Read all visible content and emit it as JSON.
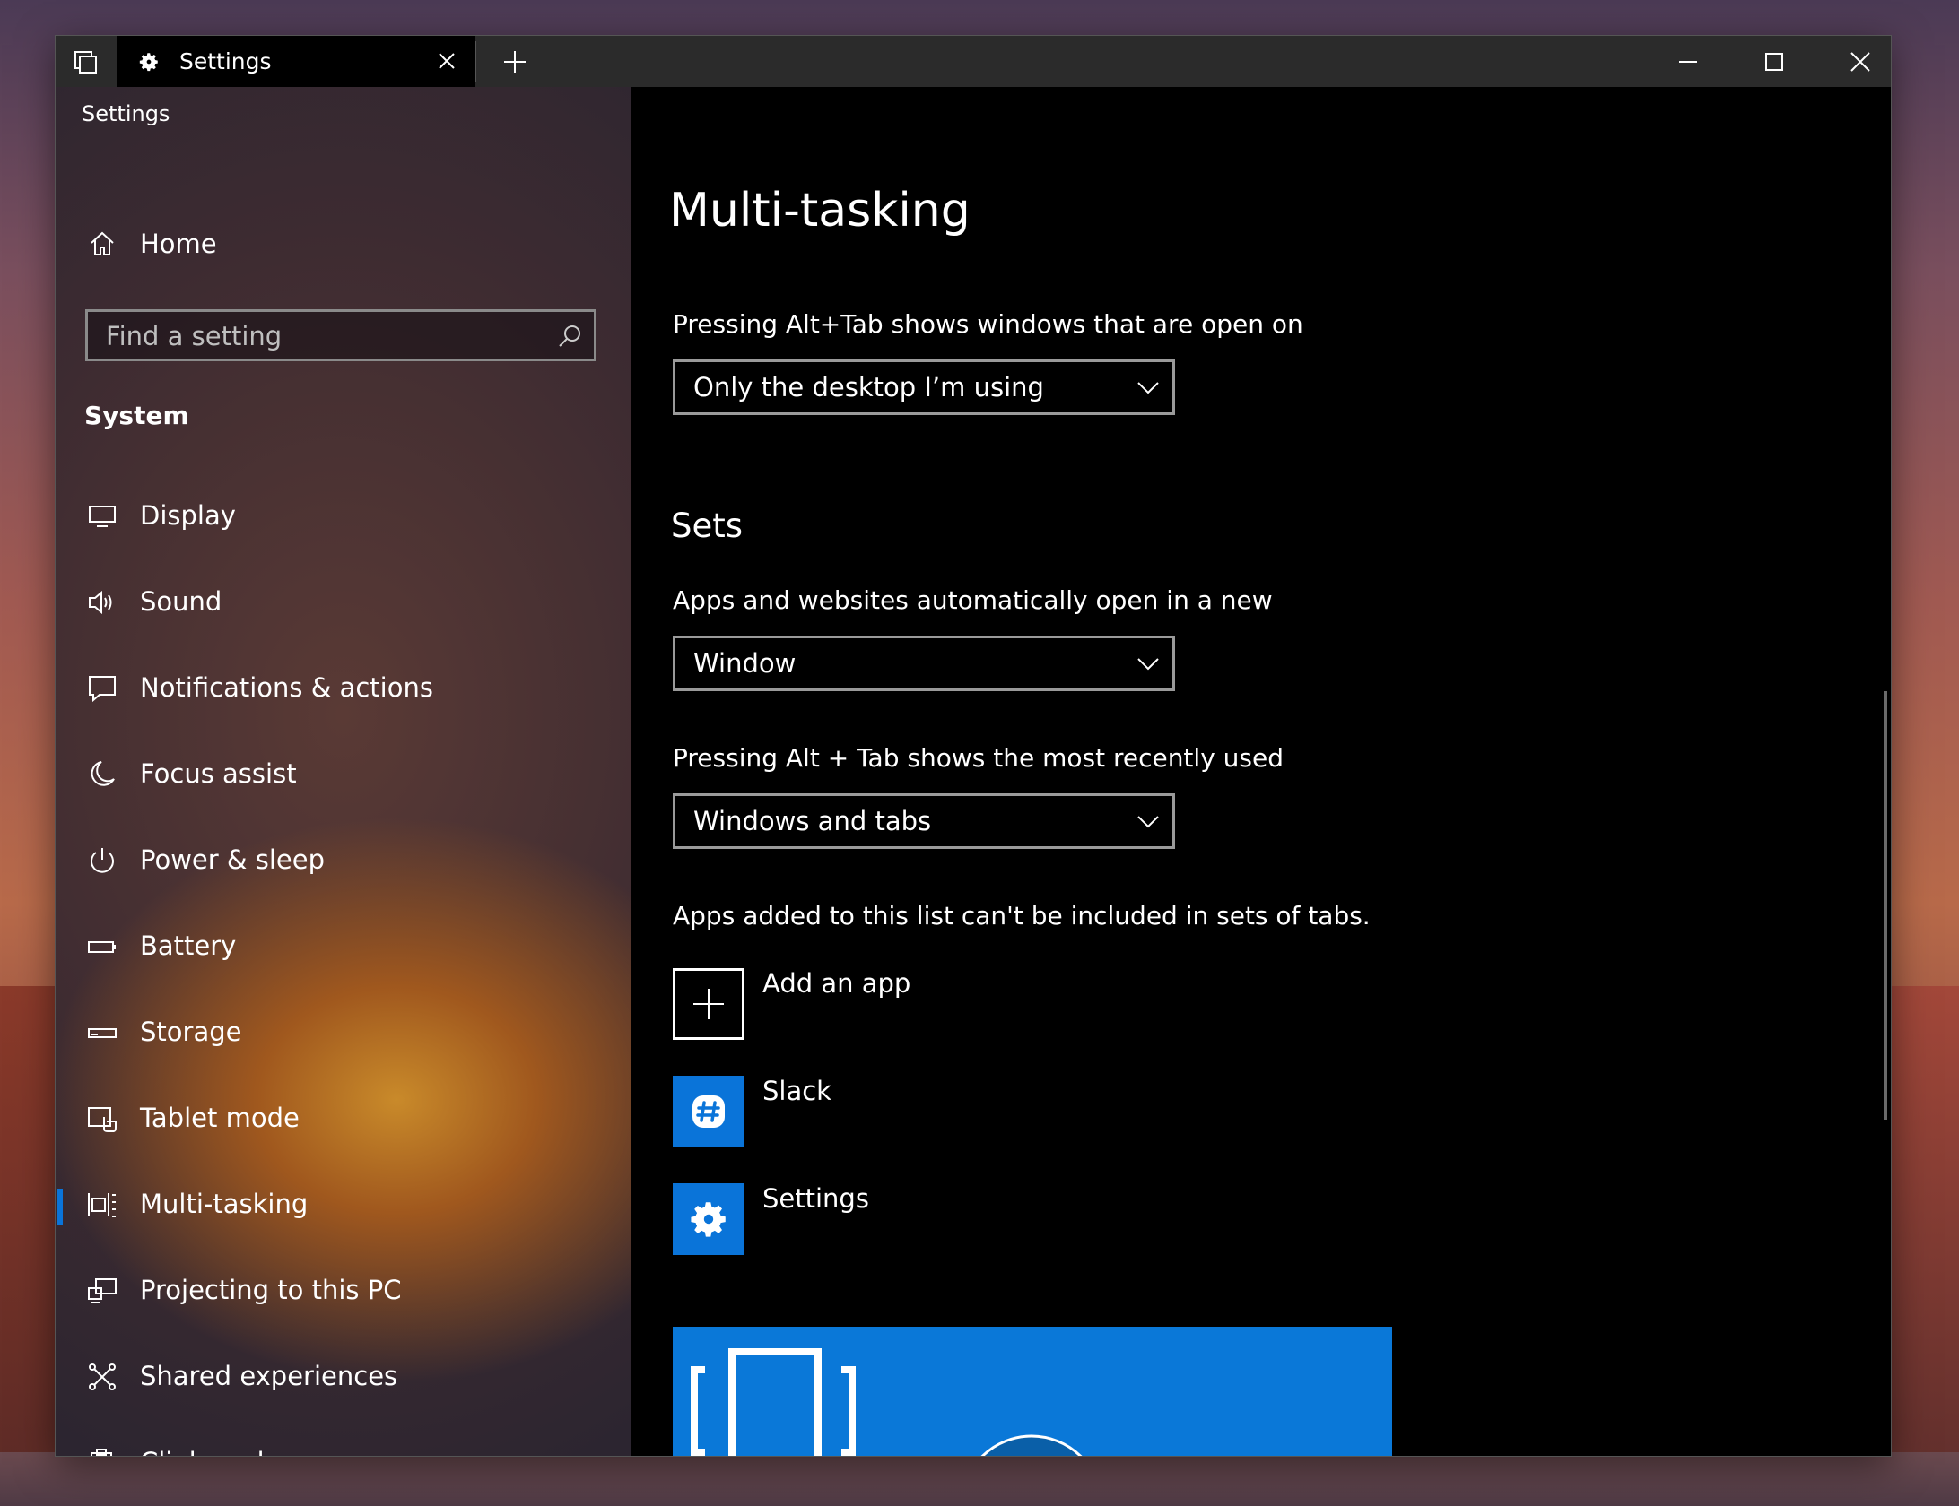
{
  "window": {
    "tab_title": "Settings",
    "app_label": "Settings",
    "icons": {
      "task_view": "task-view-icon",
      "gear": "gear-icon",
      "close_tab": "close-icon",
      "new_tab": "plus-icon",
      "minimize": "minimize-icon",
      "maximize": "maximize-icon",
      "close": "close-icon"
    }
  },
  "sidebar": {
    "home_label": "Home",
    "search_placeholder": "Find a setting",
    "section_title": "System",
    "items": [
      {
        "label": "Display",
        "icon": "display-icon"
      },
      {
        "label": "Sound",
        "icon": "speaker-icon"
      },
      {
        "label": "Notifications & actions",
        "icon": "notification-icon"
      },
      {
        "label": "Focus assist",
        "icon": "moon-icon"
      },
      {
        "label": "Power & sleep",
        "icon": "power-icon"
      },
      {
        "label": "Battery",
        "icon": "battery-icon"
      },
      {
        "label": "Storage",
        "icon": "storage-icon"
      },
      {
        "label": "Tablet mode",
        "icon": "tablet-mode-icon"
      },
      {
        "label": "Multi-tasking",
        "icon": "multitasking-icon",
        "selected": true
      },
      {
        "label": "Projecting to this PC",
        "icon": "projecting-icon"
      },
      {
        "label": "Shared experiences",
        "icon": "shared-experiences-icon"
      },
      {
        "label": "Clipboard",
        "icon": "clipboard-icon"
      }
    ]
  },
  "content": {
    "title": "Multi-tasking",
    "alttab_label": "Pressing Alt+Tab shows windows that are open on",
    "alttab_value": "Only the desktop I’m using",
    "sets_heading": "Sets",
    "open_in_label": "Apps and websites automatically open in a new",
    "open_in_value": "Window",
    "recent_label": "Pressing Alt + Tab shows the most recently used",
    "recent_value": "Windows and tabs",
    "exclude_label": "Apps added to this list can't be included in sets of tabs.",
    "apps": [
      {
        "name": "Add an app",
        "icon": "plus-icon"
      },
      {
        "name": "Slack",
        "icon": "slack-icon"
      },
      {
        "name": "Settings",
        "icon": "gear-icon"
      }
    ]
  },
  "colors": {
    "accent": "#0a74d9",
    "content_bg": "#000000",
    "titlebar_bg": "#2b2b2b"
  }
}
